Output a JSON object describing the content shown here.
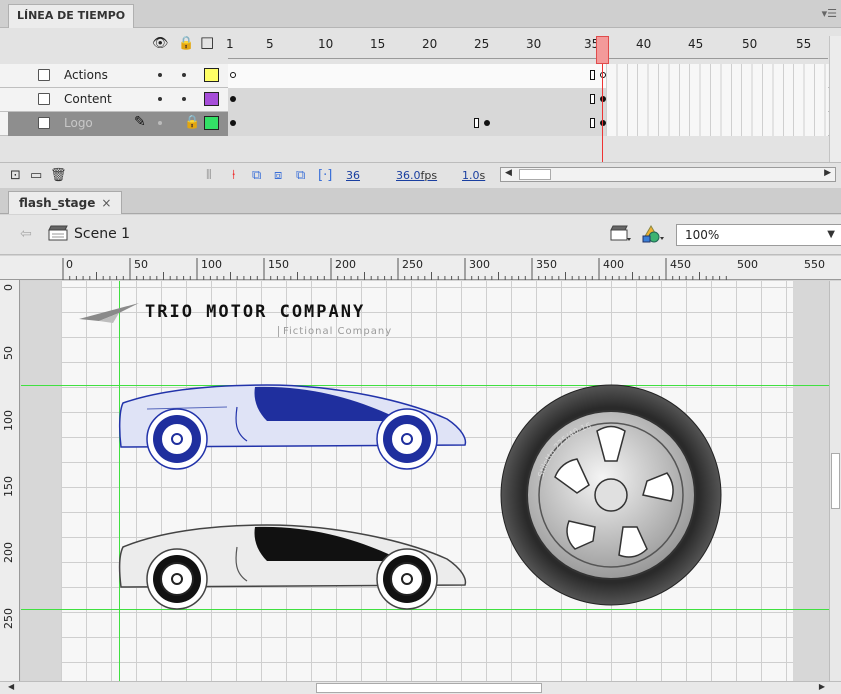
{
  "timeline": {
    "tab_label": "LÍNEA DE TIEMPO",
    "frame_numbers": [
      "1",
      "5",
      "10",
      "15",
      "20",
      "25",
      "30",
      "35",
      "40",
      "45",
      "50",
      "55"
    ],
    "layers": [
      {
        "name": "Actions",
        "color": "#ffff66"
      },
      {
        "name": "Content",
        "color": "#a64dd9"
      },
      {
        "name": "Logo",
        "color": "#33e066",
        "selected": true
      }
    ],
    "footer": {
      "current_frame": "36",
      "frame_rate": "36.0",
      "fps_unit": "fps",
      "elapsed": "1.0",
      "elapsed_unit": "s"
    }
  },
  "document": {
    "tab_label": "flash_stage",
    "tab_close": "×",
    "scene_label": "Scene 1",
    "zoom": "100%"
  },
  "ruler": {
    "top_labels": [
      "0",
      "50",
      "100",
      "150",
      "200",
      "250",
      "300",
      "350",
      "400",
      "450",
      "500",
      "550"
    ],
    "left_labels": [
      "0",
      "50",
      "100",
      "150",
      "200",
      "250"
    ]
  },
  "stage": {
    "logo_title": "TRIO MOTOR COMPANY",
    "logo_subtitle": "Fictional Company",
    "tire_text": "Stiletto 225/40-16"
  },
  "icons": [
    "eye-icon",
    "lock-icon",
    "outline-icon",
    "layer-icon",
    "pencil-icon",
    "new-layer-icon",
    "new-folder-icon",
    "trash-icon",
    "scene-icon",
    "edit-symbols-icon",
    "edit-scene-icon",
    "back-arrow-icon",
    "close-icon"
  ]
}
